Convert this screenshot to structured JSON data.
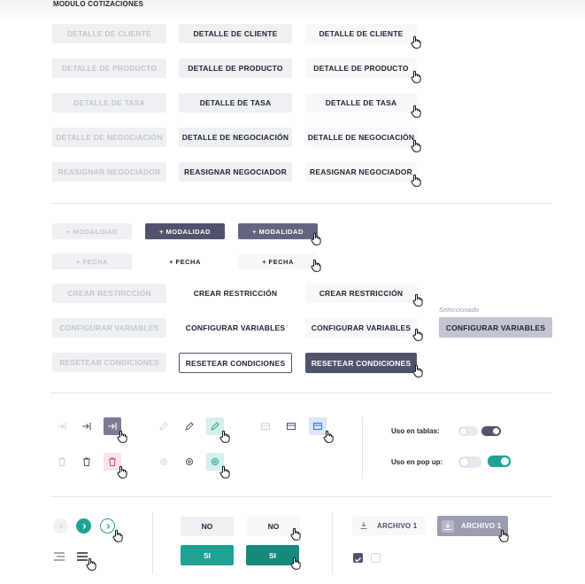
{
  "title": "MODULO COTIZACIONES",
  "detail_rows": [
    {
      "disabled": "DETALLE DE CLIENTE",
      "normal": "DETALLE DE CLIENTE",
      "hover": "DETALLE DE CLIENTE"
    },
    {
      "disabled": "DETALLE DE PRODUCTO",
      "normal": "DETALLE DE PRODUCTO",
      "hover": "DETALLE DE PRODUCTO"
    },
    {
      "disabled": "DETALLE DE TASA",
      "normal": "DETALLE DE TASA",
      "hover": "DETALLE DE TASA"
    },
    {
      "disabled": "DETALLE DE NEGOCIACIÓN",
      "normal": "DETALLE DE NEGOCIACIÓN",
      "hover": "DETALLE DE NEGOCIACIÓN"
    },
    {
      "disabled": "REASIGNAR NEGOCIADOR",
      "normal": "REASIGNAR NEGOCIADOR",
      "hover": "REASIGNAR NEGOCIADOR"
    }
  ],
  "modalidad": {
    "disabled": "+ MODALIDAD",
    "normal": "+ MODALIDAD",
    "hover": "+ MODALIDAD"
  },
  "fecha": {
    "disabled": "+ FECHA",
    "normal": "+ FECHA",
    "hover": "+ FECHA"
  },
  "config_rows": [
    {
      "disabled": "CREAR RESTRICCIÓN",
      "normal": "CREAR RESTRICCIÓN",
      "hover": "CREAR RESTRICCIÓN"
    },
    {
      "disabled": "CONFIGURAR VARIABLES",
      "normal": "CONFIGURAR VARIABLES",
      "hover": "CONFIGURAR VARIABLES",
      "selected": "CONFIGURAR VARIABLES"
    },
    {
      "disabled": "RESETEAR CONDICIONES",
      "normal": "RESETEAR CONDICIONES",
      "hover": "RESETEAR CONDICIONES"
    }
  ],
  "selected_note": "Seleccionado",
  "toggles": [
    {
      "label": "Uso en tablas:",
      "off_color": "#e8e9ef",
      "on_color": "#51536d"
    },
    {
      "label": "Uso en pop up:",
      "off_color": "#e8e9ef",
      "on_color": "#1fa294"
    }
  ],
  "yesno": {
    "no": "NO",
    "si": "SI"
  },
  "archivo": {
    "normal": "ARCHIVO 1",
    "hover": "ARCHIVO 1"
  },
  "colors": {
    "dark": "#51536d",
    "teal": "#1fa294",
    "light": "#eef0f4"
  },
  "icons": [
    "login-icon",
    "pencil-icon",
    "window-icon",
    "trash-icon",
    "gear-icon",
    "chevron-right-icon",
    "list-icon",
    "download-icon",
    "hand-cursor-icon"
  ]
}
